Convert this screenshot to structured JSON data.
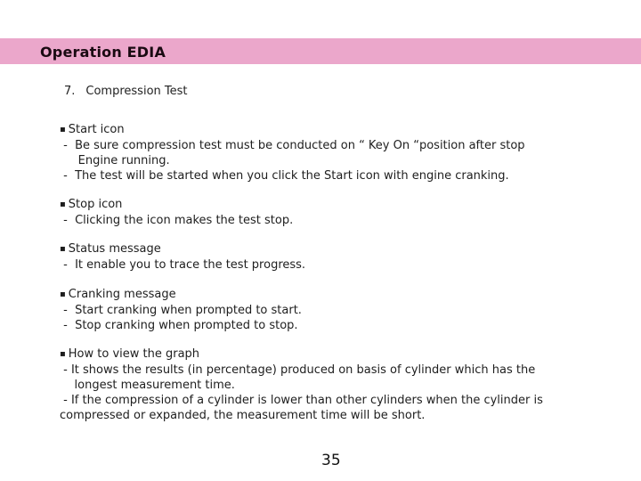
{
  "header": {
    "title": "Operation EDIA",
    "band_color": "#eba7cb"
  },
  "section": {
    "number": "7.",
    "title": "Compression Test"
  },
  "items": [
    {
      "heading": "Start icon",
      "lines": [
        " -  Be sure compression test must be conducted on “ Key On “position after stop",
        "     Engine running.",
        " -  The test will be started when you click the Start icon with engine cranking."
      ]
    },
    {
      "heading": "Stop icon",
      "lines": [
        " -  Clicking the icon makes the test stop."
      ]
    },
    {
      "heading": "Status message",
      "lines": [
        " -  It enable you to trace the test progress."
      ]
    },
    {
      "heading": "Cranking message",
      "lines": [
        " -  Start cranking when prompted to start.",
        " -  Stop cranking when prompted to stop."
      ]
    },
    {
      "heading": "How to view the graph",
      "lines": [
        " - It shows the results (in percentage) produced on basis of cylinder which has the",
        "    longest measurement time.",
        " - If the compression of a cylinder is lower than other cylinders when the cylinder is",
        "compressed or expanded, the measurement time will be short."
      ]
    }
  ],
  "page_number": "35"
}
